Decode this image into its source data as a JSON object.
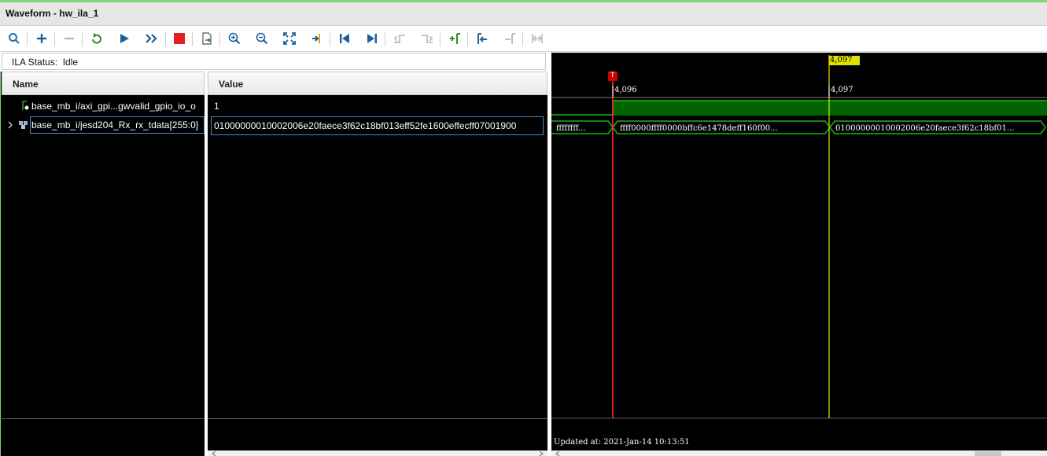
{
  "window": {
    "title": "Waveform - hw_ila_1"
  },
  "toolbar": {
    "buttons": [
      {
        "name": "search-icon"
      },
      {
        "name": "add-icon"
      },
      {
        "name": "remove-icon"
      },
      {
        "name": "refresh-icon"
      },
      {
        "name": "run-trigger-icon"
      },
      {
        "name": "run-immediate-icon"
      },
      {
        "name": "stop-icon"
      },
      {
        "name": "export-icon"
      },
      {
        "name": "zoom-in-icon"
      },
      {
        "name": "zoom-out-icon"
      },
      {
        "name": "zoom-fit-icon"
      },
      {
        "name": "go-to-cursor-icon"
      },
      {
        "name": "go-to-start-icon"
      },
      {
        "name": "go-to-end-icon"
      },
      {
        "name": "previous-transition-icon"
      },
      {
        "name": "next-transition-icon"
      },
      {
        "name": "add-marker-icon"
      },
      {
        "name": "previous-marker-icon"
      },
      {
        "name": "next-marker-icon"
      },
      {
        "name": "swap-cursors-icon"
      }
    ]
  },
  "ila_status": {
    "label": "ILA Status:",
    "value": "Idle"
  },
  "columns": {
    "name": "Name",
    "value": "Value"
  },
  "signals": [
    {
      "name": "base_mb_i/axi_gpi...gwvalid_gpio_io_o",
      "value": "1",
      "type": "bit"
    },
    {
      "name": "base_mb_i/jesd204_Rx_rx_tdata[255:0]",
      "value": "01000000010002006e20faece3f62c18bf013eff52fe1600effecff07001900",
      "type": "bus"
    }
  ],
  "waveform": {
    "marker_label": "4,097",
    "cursor_flag": "T",
    "time_labels": [
      "4,096",
      "4,097"
    ],
    "bus_values": [
      "ffffffff...",
      "ffff0000ffff0000bffc6e1478deff160f00...",
      "01000000010002006e20faece3f62c18bf01..."
    ],
    "updated": "Updated at:  2021-Jan-14 10:13:51"
  },
  "colors": {
    "green": "#19b419",
    "cursor": "#ff2a2a",
    "marker": "#e0e000"
  }
}
